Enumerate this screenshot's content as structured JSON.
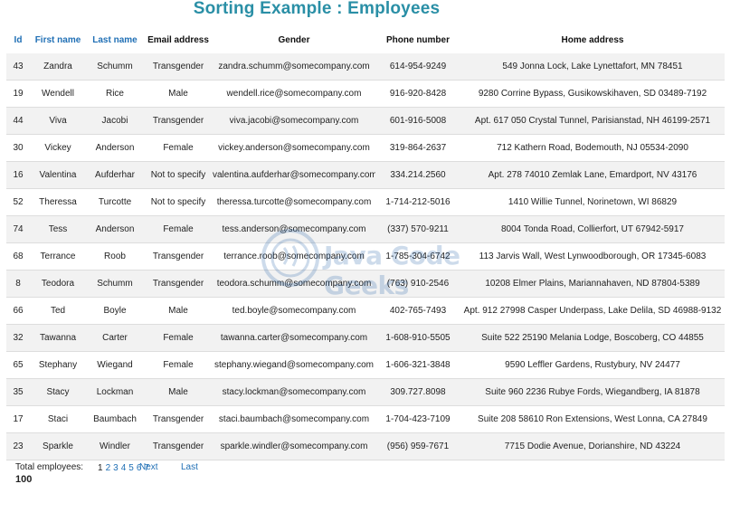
{
  "page": {
    "title": "Sorting Example : Employees"
  },
  "table": {
    "headers": {
      "id": "Id",
      "first_name": "First name",
      "last_name": "Last name",
      "email": "Email address",
      "gender": "Gender",
      "phone": "Phone number",
      "address": "Home address"
    },
    "rows": [
      [
        "43",
        "Zandra",
        "Schumm",
        "Transgender",
        "zandra.schumm@somecompany.com",
        "614-954-9249",
        "549 Jonna Lock, Lake Lynettafort, MN 78451"
      ],
      [
        "19",
        "Wendell",
        "Rice",
        "Male",
        "wendell.rice@somecompany.com",
        "916-920-8428",
        "9280 Corrine Bypass, Gusikowskihaven, SD 03489-7192"
      ],
      [
        "44",
        "Viva",
        "Jacobi",
        "Transgender",
        "viva.jacobi@somecompany.com",
        "601-916-5008",
        "Apt. 617 050 Crystal Tunnel, Parisianstad, NH 46199-2571"
      ],
      [
        "30",
        "Vickey",
        "Anderson",
        "Female",
        "vickey.anderson@somecompany.com",
        "319-864-2637",
        "712 Kathern Road, Bodemouth, NJ 05534-2090"
      ],
      [
        "16",
        "Valentina",
        "Aufderhar",
        "Not to specify",
        "valentina.aufderhar@somecompany.com",
        "334.214.2560",
        "Apt. 278 74010 Zemlak Lane, Emardport, NV 43176"
      ],
      [
        "52",
        "Theressa",
        "Turcotte",
        "Not to specify",
        "theressa.turcotte@somecompany.com",
        "1-714-212-5016",
        "1410 Willie Tunnel, Norinetown, WI 86829"
      ],
      [
        "74",
        "Tess",
        "Anderson",
        "Female",
        "tess.anderson@somecompany.com",
        "(337) 570-9211",
        "8004 Tonda Road, Collierfort, UT 67942-5917"
      ],
      [
        "68",
        "Terrance",
        "Roob",
        "Transgender",
        "terrance.roob@somecompany.com",
        "1-785-304-6742",
        "113 Jarvis Wall, West Lynwoodborough, OR 17345-6083"
      ],
      [
        "8",
        "Teodora",
        "Schumm",
        "Transgender",
        "teodora.schumm@somecompany.com",
        "(763) 910-2546",
        "10208 Elmer Plains, Mariannahaven, ND 87804-5389"
      ],
      [
        "66",
        "Ted",
        "Boyle",
        "Male",
        "ted.boyle@somecompany.com",
        "402-765-7493",
        "Apt. 912 27998 Casper Underpass, Lake Delila, SD 46988-9132"
      ],
      [
        "32",
        "Tawanna",
        "Carter",
        "Female",
        "tawanna.carter@somecompany.com",
        "1-608-910-5505",
        "Suite 522 25190 Melania Lodge, Boscoberg, CO 44855"
      ],
      [
        "65",
        "Stephany",
        "Wiegand",
        "Female",
        "stephany.wiegand@somecompany.com",
        "1-606-321-3848",
        "9590 Leffler Gardens, Rustybury, NV 24477"
      ],
      [
        "35",
        "Stacy",
        "Lockman",
        "Male",
        "stacy.lockman@somecompany.com",
        "309.727.8098",
        "Suite 960 2236 Rubye Fords, Wiegandberg, IA 81878"
      ],
      [
        "17",
        "Staci",
        "Baumbach",
        "Transgender",
        "staci.baumbach@somecompany.com",
        "1-704-423-7109",
        "Suite 208 58610 Ron Extensions, West Lonna, CA 27849"
      ],
      [
        "23",
        "Sparkle",
        "Windler",
        "Transgender",
        "sparkle.windler@somecompany.com",
        "(956) 959-7671",
        "7715 Dodie Avenue, Dorianshire, ND 43224"
      ]
    ]
  },
  "footer": {
    "total_label": "Total employees:",
    "total_value": "100",
    "pages": [
      "1",
      "2",
      "3",
      "4",
      "5",
      "6",
      "7"
    ],
    "current_page": "1",
    "next_label": "Next",
    "last_label": "Last"
  },
  "watermark": {
    "text": "Java Code Geeks"
  },
  "colors": {
    "title": "#2a8fa6",
    "link": "#1f6fb5",
    "stripe": "#f2f2f2"
  }
}
